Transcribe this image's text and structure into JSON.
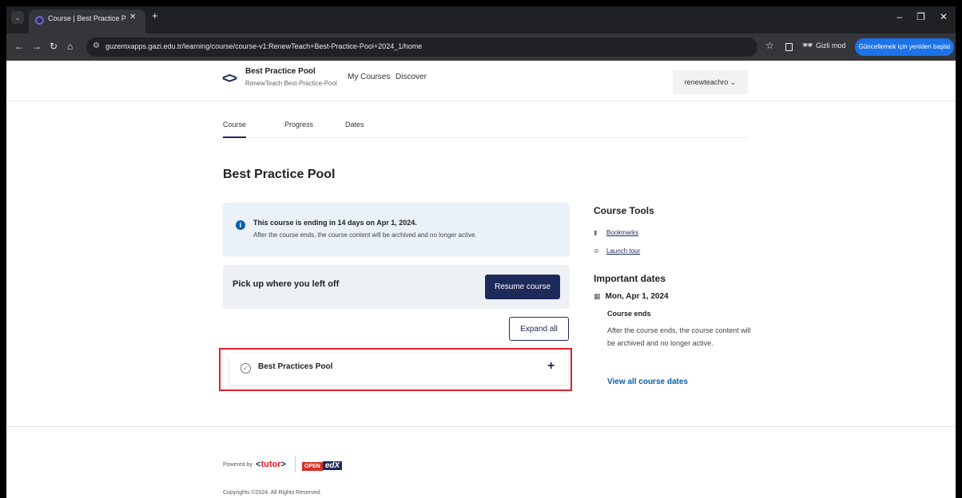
{
  "browser": {
    "tab_title": "Course | Best Practice Pool | Gu",
    "url": "guzemxapps.gazi.edu.tr/learning/course/course-v1:RenewTeach+Best-Practice-Pool+2024_1/home",
    "incognito_label": "Gizli mod",
    "update_button": "Güncellemek için yeniden başlat"
  },
  "header": {
    "course_title": "Best Practice Pool",
    "course_subtitle": "RenewTeach Best-Practice-Pool",
    "nav": [
      "My Courses",
      "Discover"
    ],
    "username": "renewteachro"
  },
  "course_tabs": [
    "Course",
    "Progress",
    "Dates"
  ],
  "main": {
    "title": "Best Practice Pool",
    "alert": {
      "title": "This course is ending in 14 days on Apr 1, 2024.",
      "body": "After the course ends, the course content will be archived and no longer active."
    },
    "resume": {
      "text": "Pick up where you left off",
      "button": "Resume course"
    },
    "expand_all": "Expand all",
    "section": {
      "title": "Best Practices Pool"
    }
  },
  "sidebar": {
    "tools_title": "Course Tools",
    "tools": [
      "Bookmarks",
      "Launch tour"
    ],
    "dates_title": "Important dates",
    "date": "Mon, Apr 1, 2024",
    "event_title": "Course ends",
    "event_desc": "After the course ends, the course content will be archived and no longer active.",
    "view_all": "View all course dates"
  },
  "footer": {
    "powered_by": "Powered by",
    "tutor": "tutor",
    "openedx_open": "OPEN",
    "openedx_edx": "edX",
    "copyright": "Copyrights ©2024. All Rights Reserved."
  },
  "colors": {
    "brand": "#1e2a5a",
    "highlight": "#e0202a",
    "info": "#0a5ea8"
  }
}
